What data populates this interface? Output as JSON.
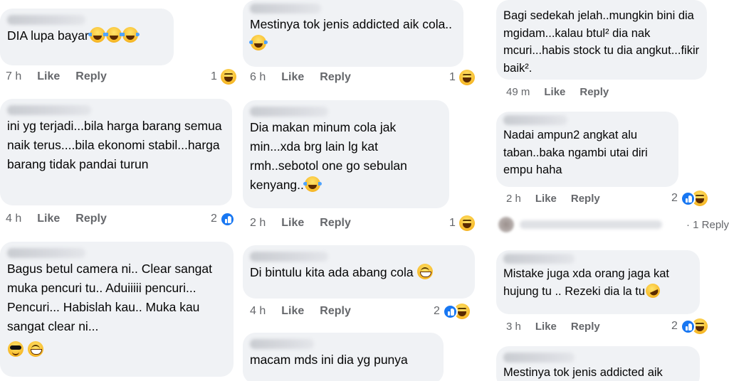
{
  "colors": {
    "bubble": "#f0f2f5",
    "meta": "#65676b",
    "like_blue": "#1877f2"
  },
  "col1": [
    {
      "text": "DIA lupa bayar",
      "emojis": [
        "tears-icon",
        "tears-icon",
        "tears-icon"
      ],
      "time": "7 h",
      "like": "Like",
      "reply": "Reply",
      "count": "1"
    },
    {
      "text": "ini yg terjadi...bila harga barang semua naik terus....bila ekonomi stabil...harga barang tidak pandai turun",
      "time": "4 h",
      "like": "Like",
      "reply": "Reply",
      "count": "2"
    },
    {
      "text": "Bagus betul camera ni.. Clear sangat muka pencuri tu..  Aduiiiii pencuri... Pencuri... Habislah kau.. Muka kau sangat clear ni..."
    }
  ],
  "col2": [
    {
      "text": "Mestinya tok jenis  addicted aik cola..",
      "time": "6 h",
      "like": "Like",
      "reply": "Reply",
      "count": "1"
    },
    {
      "text": "Dia makan minum cola jak min...xda brg lain lg kat rmh..sebotol one go  sebulan kenyang..",
      "time": "2 h",
      "like": "Like",
      "reply": "Reply",
      "count": "1"
    },
    {
      "text": "Di bintulu kita ada abang cola",
      "time": "4 h",
      "like": "Like",
      "reply": "Reply",
      "count": "2"
    },
    {
      "text": "macam mds ini dia yg punya"
    }
  ],
  "col3": [
    {
      "text": "Bagi sedekah jelah..mungkin bini dia mgidam...kalau btul² dia nak mcuri...habis stock tu dia angkut...fikir baik².",
      "time": "49 m",
      "like": "Like",
      "reply": "Reply"
    },
    {
      "text": "Nadai ampun2 angkat alu taban..baka ngambi utai diri empu haha",
      "time": "2 h",
      "like": "Like",
      "reply": "Reply",
      "count": "2"
    },
    {
      "replies": "· 1 Reply"
    },
    {
      "text": "Mistake juga xda orang jaga kat hujung tu .. Rezeki dia la tu",
      "time": "3 h",
      "like": "Like",
      "reply": "Reply",
      "count": "2"
    },
    {
      "text": "Mestinya tok jenis  addicted aik"
    }
  ]
}
